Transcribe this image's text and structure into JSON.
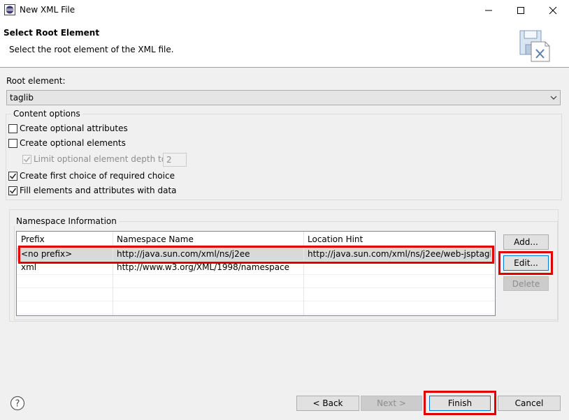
{
  "window": {
    "title": "New XML File"
  },
  "banner": {
    "title": "Select Root Element",
    "description": "Select the root element of the XML file."
  },
  "root_element": {
    "label": "Root element:",
    "value": "taglib"
  },
  "content_options": {
    "title": "Content options",
    "create_optional_attributes": {
      "label": "Create optional attributes",
      "checked": false
    },
    "create_optional_elements": {
      "label": "Create optional elements",
      "checked": false
    },
    "limit_depth": {
      "label": "Limit optional element depth to:",
      "checked": true,
      "enabled": false,
      "value": "2"
    },
    "create_first_choice": {
      "label": "Create first choice of required choice",
      "checked": true
    },
    "fill_elements": {
      "label": "Fill elements and attributes with data",
      "checked": true
    }
  },
  "namespace": {
    "title": "Namespace Information",
    "columns": [
      "Prefix",
      "Namespace Name",
      "Location Hint"
    ],
    "rows": [
      {
        "prefix": "<no prefix>",
        "name": "http://java.sun.com/xml/ns/j2ee",
        "hint": "http://java.sun.com/xml/ns/j2ee/web-jsptagli..."
      },
      {
        "prefix": "xml",
        "name": "http://www.w3.org/XML/1998/namespace",
        "hint": ""
      }
    ],
    "buttons": {
      "add": "Add...",
      "edit": "Edit...",
      "delete": "Delete"
    }
  },
  "footer": {
    "back": "< Back",
    "next": "Next >",
    "finish": "Finish",
    "cancel": "Cancel"
  },
  "colors": {
    "highlight": "#e00000",
    "selection": "#d9d9d9",
    "focus": "#0078d7"
  }
}
